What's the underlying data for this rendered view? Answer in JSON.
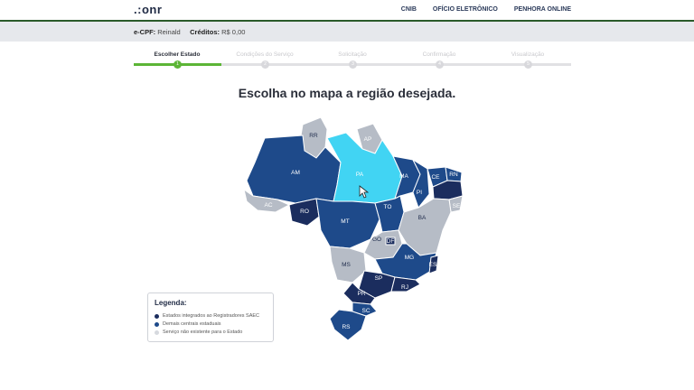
{
  "header": {
    "logo": ".:onr",
    "nav": [
      "CNIB",
      "OFÍCIO ELETRÔNICO",
      "PENHORA ONLINE"
    ]
  },
  "userbar": {
    "cpf_label": "e-CPF:",
    "cpf_value": "Reinald",
    "credits_label": "Créditos:",
    "credits_value": "R$ 0,00"
  },
  "steps": [
    {
      "label": "Escolher Estado",
      "num": "1"
    },
    {
      "label": "Condições do Serviço",
      "num": "2"
    },
    {
      "label": "Solicitação",
      "num": "3"
    },
    {
      "label": "Confirmação",
      "num": "4"
    },
    {
      "label": "Visualização",
      "num": "5"
    }
  ],
  "heading": "Escolha no mapa a região desejada.",
  "colors": {
    "integrated": "#1b2d5e",
    "central": "#1e4a8a",
    "unavailable": "#b6bcc6",
    "highlight": "#41d4f3",
    "accent": "#5cb536"
  },
  "states": {
    "AM": "AM",
    "RR": "RR",
    "AP": "AP",
    "PA": "PA",
    "AC": "AC",
    "RO": "RO",
    "MT": "MT",
    "MA": "MA",
    "PI": "PI",
    "CE": "CE",
    "RN": "RN",
    "TO": "TO",
    "BA": "BA",
    "SE": "SE",
    "GO": "GO",
    "DF": "DF",
    "MG": "MG",
    "ES": "ES",
    "MS": "MS",
    "SP": "SP",
    "RJ": "RJ",
    "PR": "PR",
    "SC": "SC",
    "RS": "RS"
  },
  "legend": {
    "title": "Legenda:",
    "items": [
      "Estados integrados ao Registradores SAEC",
      "Demais centrais estaduais",
      "Serviço não existente para o Estado"
    ]
  }
}
